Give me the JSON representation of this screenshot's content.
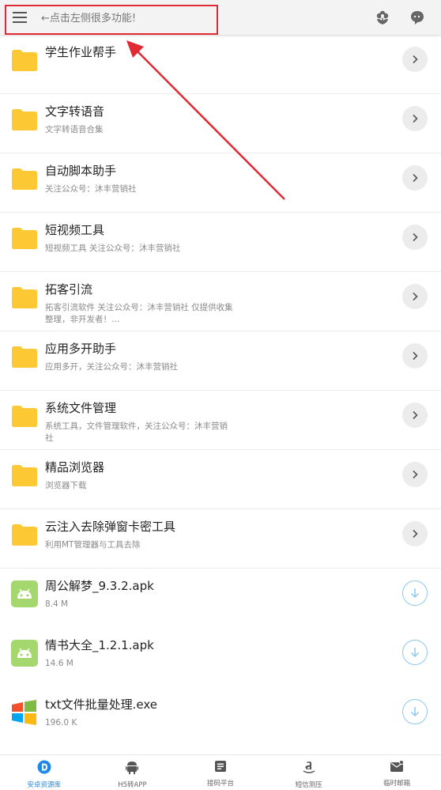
{
  "header": {
    "hint": "←点击左侧很多功能!"
  },
  "items": [
    {
      "kind": "folder",
      "title": "学生作业帮手",
      "subtitle": ""
    },
    {
      "kind": "folder",
      "title": "文字转语音",
      "subtitle": "文字转语音合集"
    },
    {
      "kind": "folder",
      "title": "自动脚本助手",
      "subtitle": "关注公众号：沐丰营销社"
    },
    {
      "kind": "folder",
      "title": "短视频工具",
      "subtitle": "短视频工具 关注公众号：沐丰营销社"
    },
    {
      "kind": "folder",
      "title": "拓客引流",
      "subtitle": "拓客引流软件 关注公众号：沐丰营销社 仅提供收集整理，非开发者！…"
    },
    {
      "kind": "folder",
      "title": "应用多开助手",
      "subtitle": "应用多开，关注公众号：沐丰营销社"
    },
    {
      "kind": "folder",
      "title": "系统文件管理",
      "subtitle": "系统工具，文件管理软件，关注公众号：沐丰营销社"
    },
    {
      "kind": "folder",
      "title": "精品浏览器",
      "subtitle": "浏览器下载"
    },
    {
      "kind": "folder",
      "title": "云注入去除弹窗卡密工具",
      "subtitle": "利用MT管理器与工具去除"
    },
    {
      "kind": "apk",
      "title": "周公解梦_9.3.2.apk",
      "subtitle": "8.4 M"
    },
    {
      "kind": "apk",
      "title": "情书大全_1.2.1.apk",
      "subtitle": "14.6 M"
    },
    {
      "kind": "exe",
      "title": "txt文件批量处理.exe",
      "subtitle": "196.0 K"
    }
  ],
  "tabs": [
    {
      "label": "安卓资源库",
      "icon": "d-logo-icon",
      "active": true
    },
    {
      "label": "H5转APP",
      "icon": "android-icon",
      "active": false
    },
    {
      "label": "接码平台",
      "icon": "document-icon",
      "active": false
    },
    {
      "label": "短信测压",
      "icon": "amazon-icon",
      "active": false
    },
    {
      "label": "临时邮箱",
      "icon": "mail-icon",
      "active": false
    }
  ],
  "colors": {
    "accent": "#1f88e5",
    "folder": "#fcc934",
    "apk": "#a4d86e",
    "annotation": "#e02b35",
    "download_ring": "#8ec9ef"
  }
}
